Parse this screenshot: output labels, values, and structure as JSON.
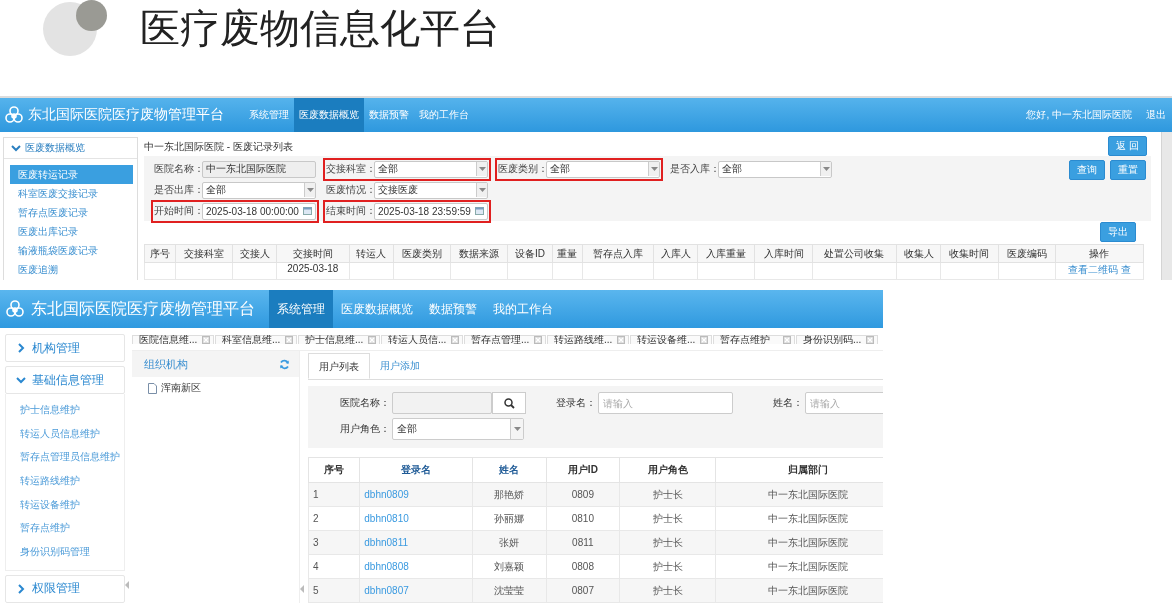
{
  "slide": {
    "title": "医疗废物信息化平台"
  },
  "screen_1": {
    "app_title": "东北国际医院医疗废物管理平台",
    "nav": [
      {
        "label": "系统管理",
        "selected": false
      },
      {
        "label": "医废数据概览",
        "selected": true
      },
      {
        "label": "数据预警",
        "selected": false
      },
      {
        "label": "我的工作台",
        "selected": false
      }
    ],
    "greeting": "您好, 中一东北国际医院",
    "logout": "退出",
    "sidebar": {
      "title": "医废数据概览",
      "expanded": true,
      "items": [
        {
          "label": "医废转运记录",
          "selected": true
        },
        {
          "label": "科室医废交接记录",
          "selected": false
        },
        {
          "label": "暂存点医废记录",
          "selected": false
        },
        {
          "label": "医废出库记录",
          "selected": false
        },
        {
          "label": "输液瓶袋医废记录",
          "selected": false
        },
        {
          "label": "医废追溯",
          "selected": false
        }
      ]
    },
    "breadcrumb": "中一东北国际医院 - 医废记录列表",
    "back_button": "返 回",
    "filters": [
      [
        {
          "label": "医院名称：",
          "kind": "readonly",
          "value": "中一东北国际医院",
          "highlighted": false
        },
        {
          "label": "交接科室：",
          "kind": "select",
          "value": "全部",
          "highlighted": true
        },
        {
          "label": "医废类别：",
          "kind": "select",
          "value": "全部",
          "highlighted": true
        },
        {
          "label": "是否入库：",
          "kind": "select",
          "value": "全部",
          "highlighted": false
        }
      ],
      [
        {
          "label": "是否出库：",
          "kind": "select",
          "value": "全部",
          "highlighted": false
        },
        {
          "label": "医废情况：",
          "kind": "select",
          "value": "交接医废",
          "highlighted": false
        }
      ],
      [
        {
          "label": "开始时间：",
          "kind": "datetime",
          "value": "2025-03-18 00:00:00",
          "highlighted": true
        },
        {
          "label": "结束时间：",
          "kind": "datetime",
          "value": "2025-03-18 23:59:59",
          "highlighted": true
        }
      ]
    ],
    "buttons": [
      "查询",
      "重置"
    ],
    "export_button": "导出",
    "table": {
      "columns": [
        "序号",
        "交接科室",
        "交接人",
        "交接时间",
        "转运人",
        "医废类别",
        "数据来源",
        "设备ID",
        "重量",
        "暂存点入库",
        "入库人",
        "入库重量",
        "入库时间",
        "处置公司收集",
        "收集人",
        "收集时间",
        "医废编码",
        "操作"
      ],
      "partial_row": {
        "handover_time": "2025-03-18",
        "actions": "查看二维码 查"
      }
    }
  },
  "screen_2": {
    "app_title": "东北国际医院医疗废物管理平台",
    "nav": [
      {
        "label": "系统管理",
        "selected": true
      },
      {
        "label": "医废数据概览",
        "selected": false
      },
      {
        "label": "数据预警",
        "selected": false
      },
      {
        "label": "我的工作台",
        "selected": false
      }
    ],
    "sidebar": [
      {
        "label": "机构管理",
        "expanded": false
      },
      {
        "label": "基础信息管理",
        "expanded": true,
        "items": [
          "护士信息维护",
          "转运人员信息维护",
          "暂存点管理员信息维护",
          "转运路线维护",
          "转运设备维护",
          "暂存点维护",
          "身份识别码管理"
        ]
      },
      {
        "label": "权限管理",
        "expanded": false
      }
    ],
    "open_tabs": [
      "医院信息维...",
      "科室信息维...",
      "护士信息维...",
      "转运人员信...",
      "暂存点管理...",
      "转运路线维...",
      "转运设备维...",
      "暂存点维护",
      "身份识别码..."
    ],
    "tree": {
      "title": "组织机构",
      "nodes": [
        "浑南新区"
      ]
    },
    "panel_tabs": [
      {
        "label": "用户列表",
        "selected": true
      },
      {
        "label": "用户添加",
        "selected": false
      }
    ],
    "filters": [
      [
        {
          "label": "医院名称：",
          "kind": "search"
        },
        {
          "label": "登录名：",
          "kind": "text",
          "placeholder": "请输入"
        },
        {
          "label": "姓名：",
          "kind": "text",
          "placeholder": "请输入"
        }
      ],
      [
        {
          "label": "用户角色：",
          "kind": "select",
          "value": "全部"
        }
      ]
    ],
    "table": {
      "columns": [
        {
          "label": "序号",
          "sortable": false,
          "link": false
        },
        {
          "label": "登录名",
          "sortable": true,
          "link": true
        },
        {
          "label": "姓名",
          "sortable": true,
          "link": false
        },
        {
          "label": "用户ID",
          "sortable": false,
          "link": false
        },
        {
          "label": "用户角色",
          "sortable": false,
          "link": false
        },
        {
          "label": "归属部门",
          "sortable": false,
          "link": false
        }
      ],
      "rows": [
        [
          "1",
          "dbhn0809",
          "那艳娇",
          "0809",
          "护士长",
          "中一东北国际医院"
        ],
        [
          "2",
          "dbhn0810",
          "孙丽娜",
          "0810",
          "护士长",
          "中一东北国际医院"
        ],
        [
          "3",
          "dbhn0811",
          "张妍",
          "0811",
          "护士长",
          "中一东北国际医院"
        ],
        [
          "4",
          "dbhn0808",
          "刘嘉颖",
          "0808",
          "护士长",
          "中一东北国际医院"
        ],
        [
          "5",
          "dbhn0807",
          "沈莹莹",
          "0807",
          "护士长",
          "中一东北国际医院"
        ]
      ]
    }
  }
}
